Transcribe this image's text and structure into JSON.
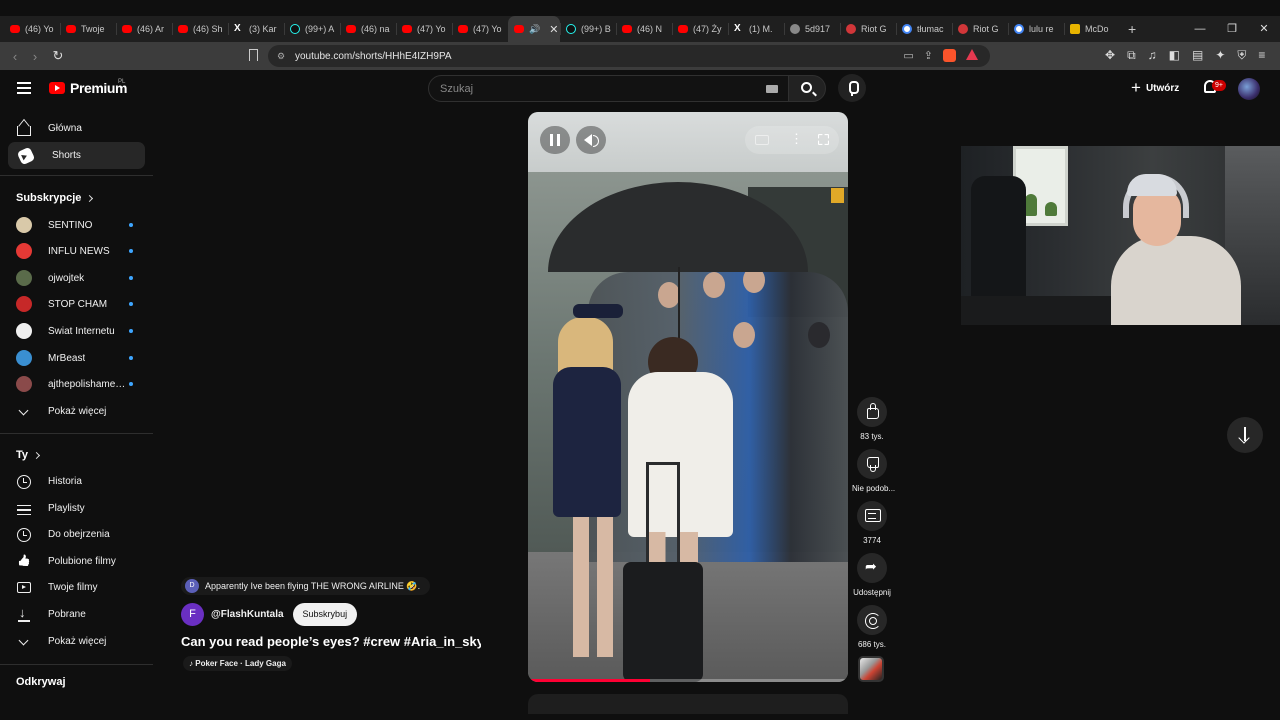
{
  "browser": {
    "tabs": [
      {
        "label": "(46) Yo",
        "icon": "youtube-icon"
      },
      {
        "label": "Twoje",
        "icon": "youtube-icon"
      },
      {
        "label": "(46) Ar",
        "icon": "youtube-icon"
      },
      {
        "label": "(46) Sh",
        "icon": "youtube-icon"
      },
      {
        "label": "(3) Kar",
        "icon": "x-icon"
      },
      {
        "label": "(99+) A",
        "icon": "tiktok-icon"
      },
      {
        "label": "(46) na",
        "icon": "youtube-icon"
      },
      {
        "label": "(47) Yo",
        "icon": "youtube-icon"
      },
      {
        "label": "(47) Yo",
        "icon": "youtube-icon"
      },
      {
        "label": "",
        "icon": "youtube-icon",
        "active": true
      },
      {
        "label": "(99+) B",
        "icon": "tiktok-icon"
      },
      {
        "label": "(46) N",
        "icon": "youtube-icon"
      },
      {
        "label": "(47) Ży",
        "icon": "youtube-icon"
      },
      {
        "label": "(1) M.",
        "icon": "x-icon"
      },
      {
        "label": "5d917",
        "icon": "generic-icon"
      },
      {
        "label": "Riot G",
        "icon": "riot-icon"
      },
      {
        "label": "tłumac",
        "icon": "google-icon"
      },
      {
        "label": "Riot G",
        "icon": "riot-icon"
      },
      {
        "label": "lulu re",
        "icon": "google-icon"
      },
      {
        "label": "McDo",
        "icon": "mcdonalds-icon"
      }
    ],
    "url": "youtube.com/shorts/HHhE4IZH9PA"
  },
  "header": {
    "logo_text": "Premium",
    "logo_region": "PL",
    "search_placeholder": "Szukaj",
    "create_label": "Utwórz",
    "notification_count": "9+"
  },
  "sidebar": {
    "main": [
      {
        "label": "Główna",
        "icon": "home-icon"
      },
      {
        "label": "Shorts",
        "icon": "shorts-icon",
        "active": true
      }
    ],
    "subscriptions_title": "Subskrypcje",
    "subscriptions": [
      {
        "label": "SENTINO",
        "color": "#d9c9a9"
      },
      {
        "label": "INFLU NEWS",
        "color": "#e53935"
      },
      {
        "label": "ojwojtek",
        "color": "#5a6b4a"
      },
      {
        "label": "STOP CHAM",
        "color": "#c62828"
      },
      {
        "label": "Świat Internetu",
        "color": "#f0f0f0"
      },
      {
        "label": "MrBeast",
        "color": "#3a8fd1"
      },
      {
        "label": "ajthepolishameri...",
        "color": "#8a4a4a"
      }
    ],
    "show_more": "Pokaż więcej",
    "you_title": "Ty",
    "you_items": [
      {
        "label": "Historia",
        "icon": "history-icon"
      },
      {
        "label": "Playlisty",
        "icon": "playlist-icon"
      },
      {
        "label": "Do obejrzenia",
        "icon": "watch-later-icon"
      },
      {
        "label": "Polubione filmy",
        "icon": "liked-icon"
      },
      {
        "label": "Twoje filmy",
        "icon": "your-videos-icon"
      },
      {
        "label": "Pobrane",
        "icon": "download-icon"
      }
    ],
    "show_more_2": "Pokaż więcej",
    "explore_title": "Odkrywaj"
  },
  "short": {
    "promo_initial": "D",
    "promo_text": "Apparently Ive been flying THE WRONG AIRLINE 🤣.",
    "channel_initial": "F",
    "channel_name": "@FlashKuntala",
    "subscribe_label": "Subskrybuj",
    "title": "Can you read people’s eyes? #crew #Aria_in_sky...",
    "music": "Poker Face · Lady Gaga",
    "progress": 0.38
  },
  "actions": {
    "likes": "83 tys.",
    "dislike_label": "Nie podob...",
    "comments": "3774",
    "share_label": "Udostępnij",
    "remix_count": "686 tys."
  }
}
